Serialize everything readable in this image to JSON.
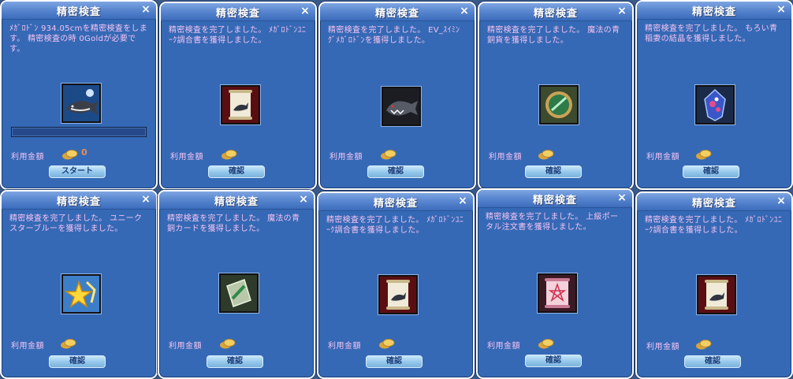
{
  "title": "精密検査",
  "fee_label": "利用金額",
  "close_glyph": "×",
  "windows": [
    {
      "message": "ﾒｶﾞﾛﾄﾞﾝ 934.05cmを精密検査をします。 精密検査の時 0Goldが必要です。",
      "icon": "megalodon-icon",
      "fee": "0",
      "button": "スタート"
    },
    {
      "message": "精密検査を完了しました。 ﾒｶﾞﾛﾄﾞﾝﾕﾆｰｸ調合書を獲得しました。",
      "icon": "recipe-scroll-icon",
      "fee": "",
      "button": "確認"
    },
    {
      "message": "精密検査を完了しました。 EV_ｽｲﾐﾝｸﾞﾒｶﾞﾛﾄﾞﾝを獲得しました。",
      "icon": "shark-icon",
      "fee": "",
      "button": "確認"
    },
    {
      "message": "精密検査を完了しました。 魔法の青銅貨を獲得しました。",
      "icon": "bronze-coin-icon",
      "fee": "",
      "button": "確認"
    },
    {
      "message": "精密検査を完了しました。 もろい青稲妻の結晶を獲得しました。",
      "icon": "crystal-icon",
      "fee": "",
      "button": "確認"
    },
    {
      "message": "精密検査を完了しました。 ユニークスターブルーを獲得しました。",
      "icon": "star-item-icon",
      "fee": "",
      "button": "確認"
    },
    {
      "message": "精密検査を完了しました。 魔法の青銅カードを獲得しました。",
      "icon": "bronze-card-icon",
      "fee": "",
      "button": "確認"
    },
    {
      "message": "精密検査を完了しました。 ﾒｶﾞﾛﾄﾞﾝﾕﾆｰｸ調合書を獲得しました。",
      "icon": "recipe-scroll-icon",
      "fee": "",
      "button": "確認"
    },
    {
      "message": "精密検査を完了しました。 上級ポータル注文書を獲得しました。",
      "icon": "portal-scroll-icon",
      "fee": "",
      "button": "確認"
    },
    {
      "message": "精密検査を完了しました。 ﾒｶﾞﾛﾄﾞﾝﾕﾆｰｸ調合書を獲得しました。",
      "icon": "recipe-scroll-icon",
      "fee": "",
      "button": "確認"
    }
  ]
}
